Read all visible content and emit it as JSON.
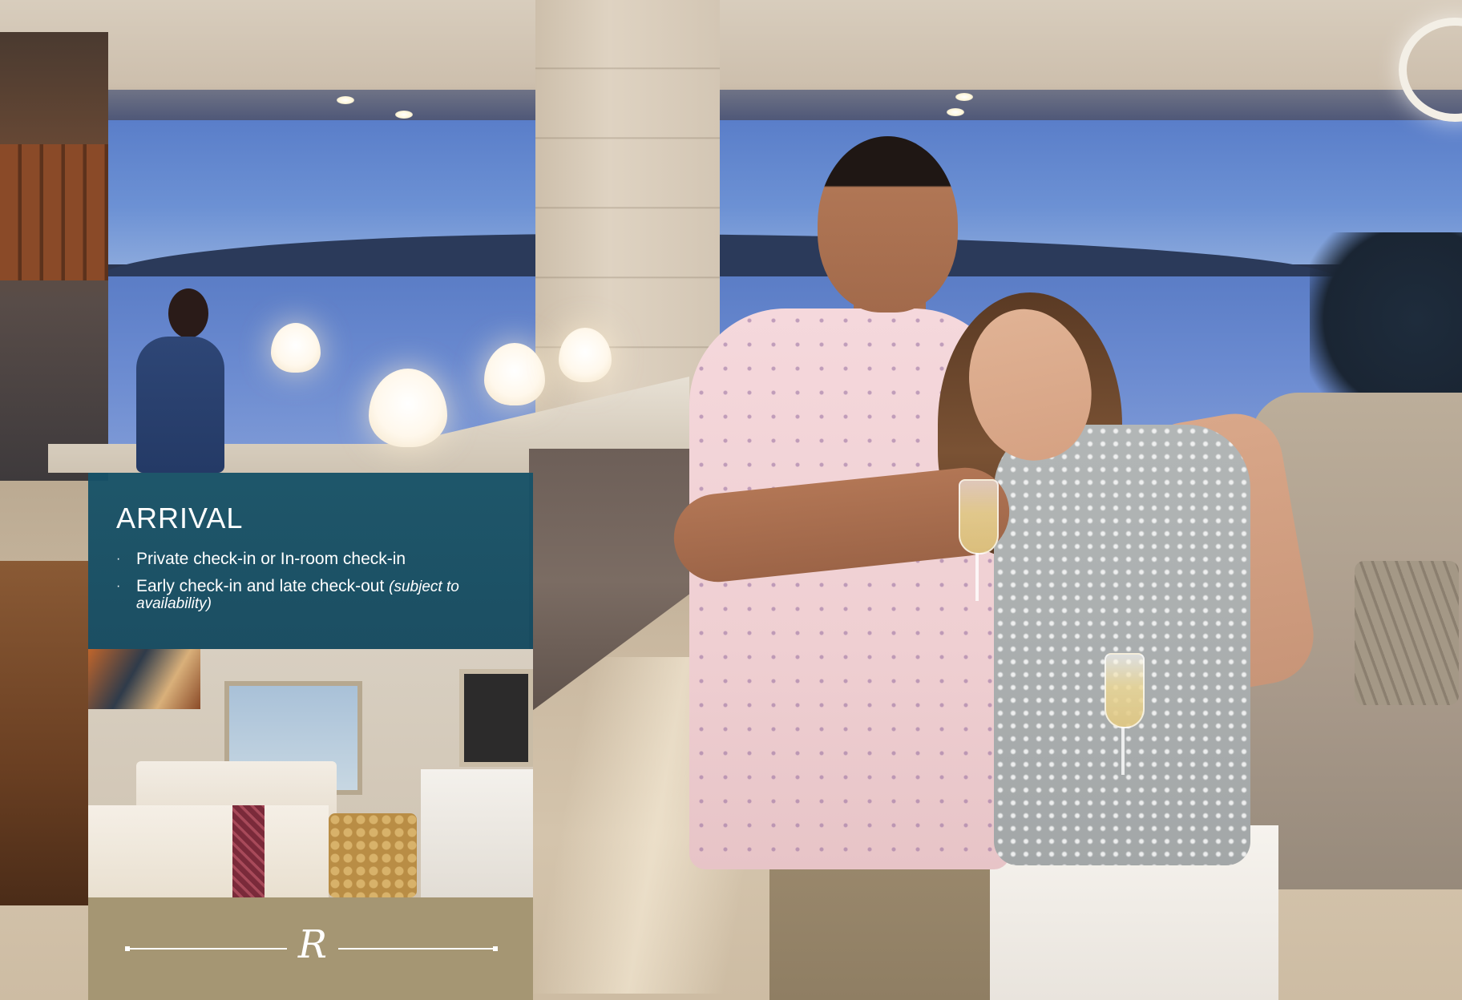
{
  "card": {
    "title": "ARRIVAL",
    "bullet": "·",
    "items": [
      {
        "text": "Private check-in or In-room check-in",
        "note": ""
      },
      {
        "text": "Early check-in and late check-out ",
        "note": "(subject to availability)"
      }
    ],
    "monogram": "R"
  },
  "colors": {
    "card_header_bg": "#165268",
    "card_footer_bg": "#a59673",
    "text": "#ffffff"
  }
}
